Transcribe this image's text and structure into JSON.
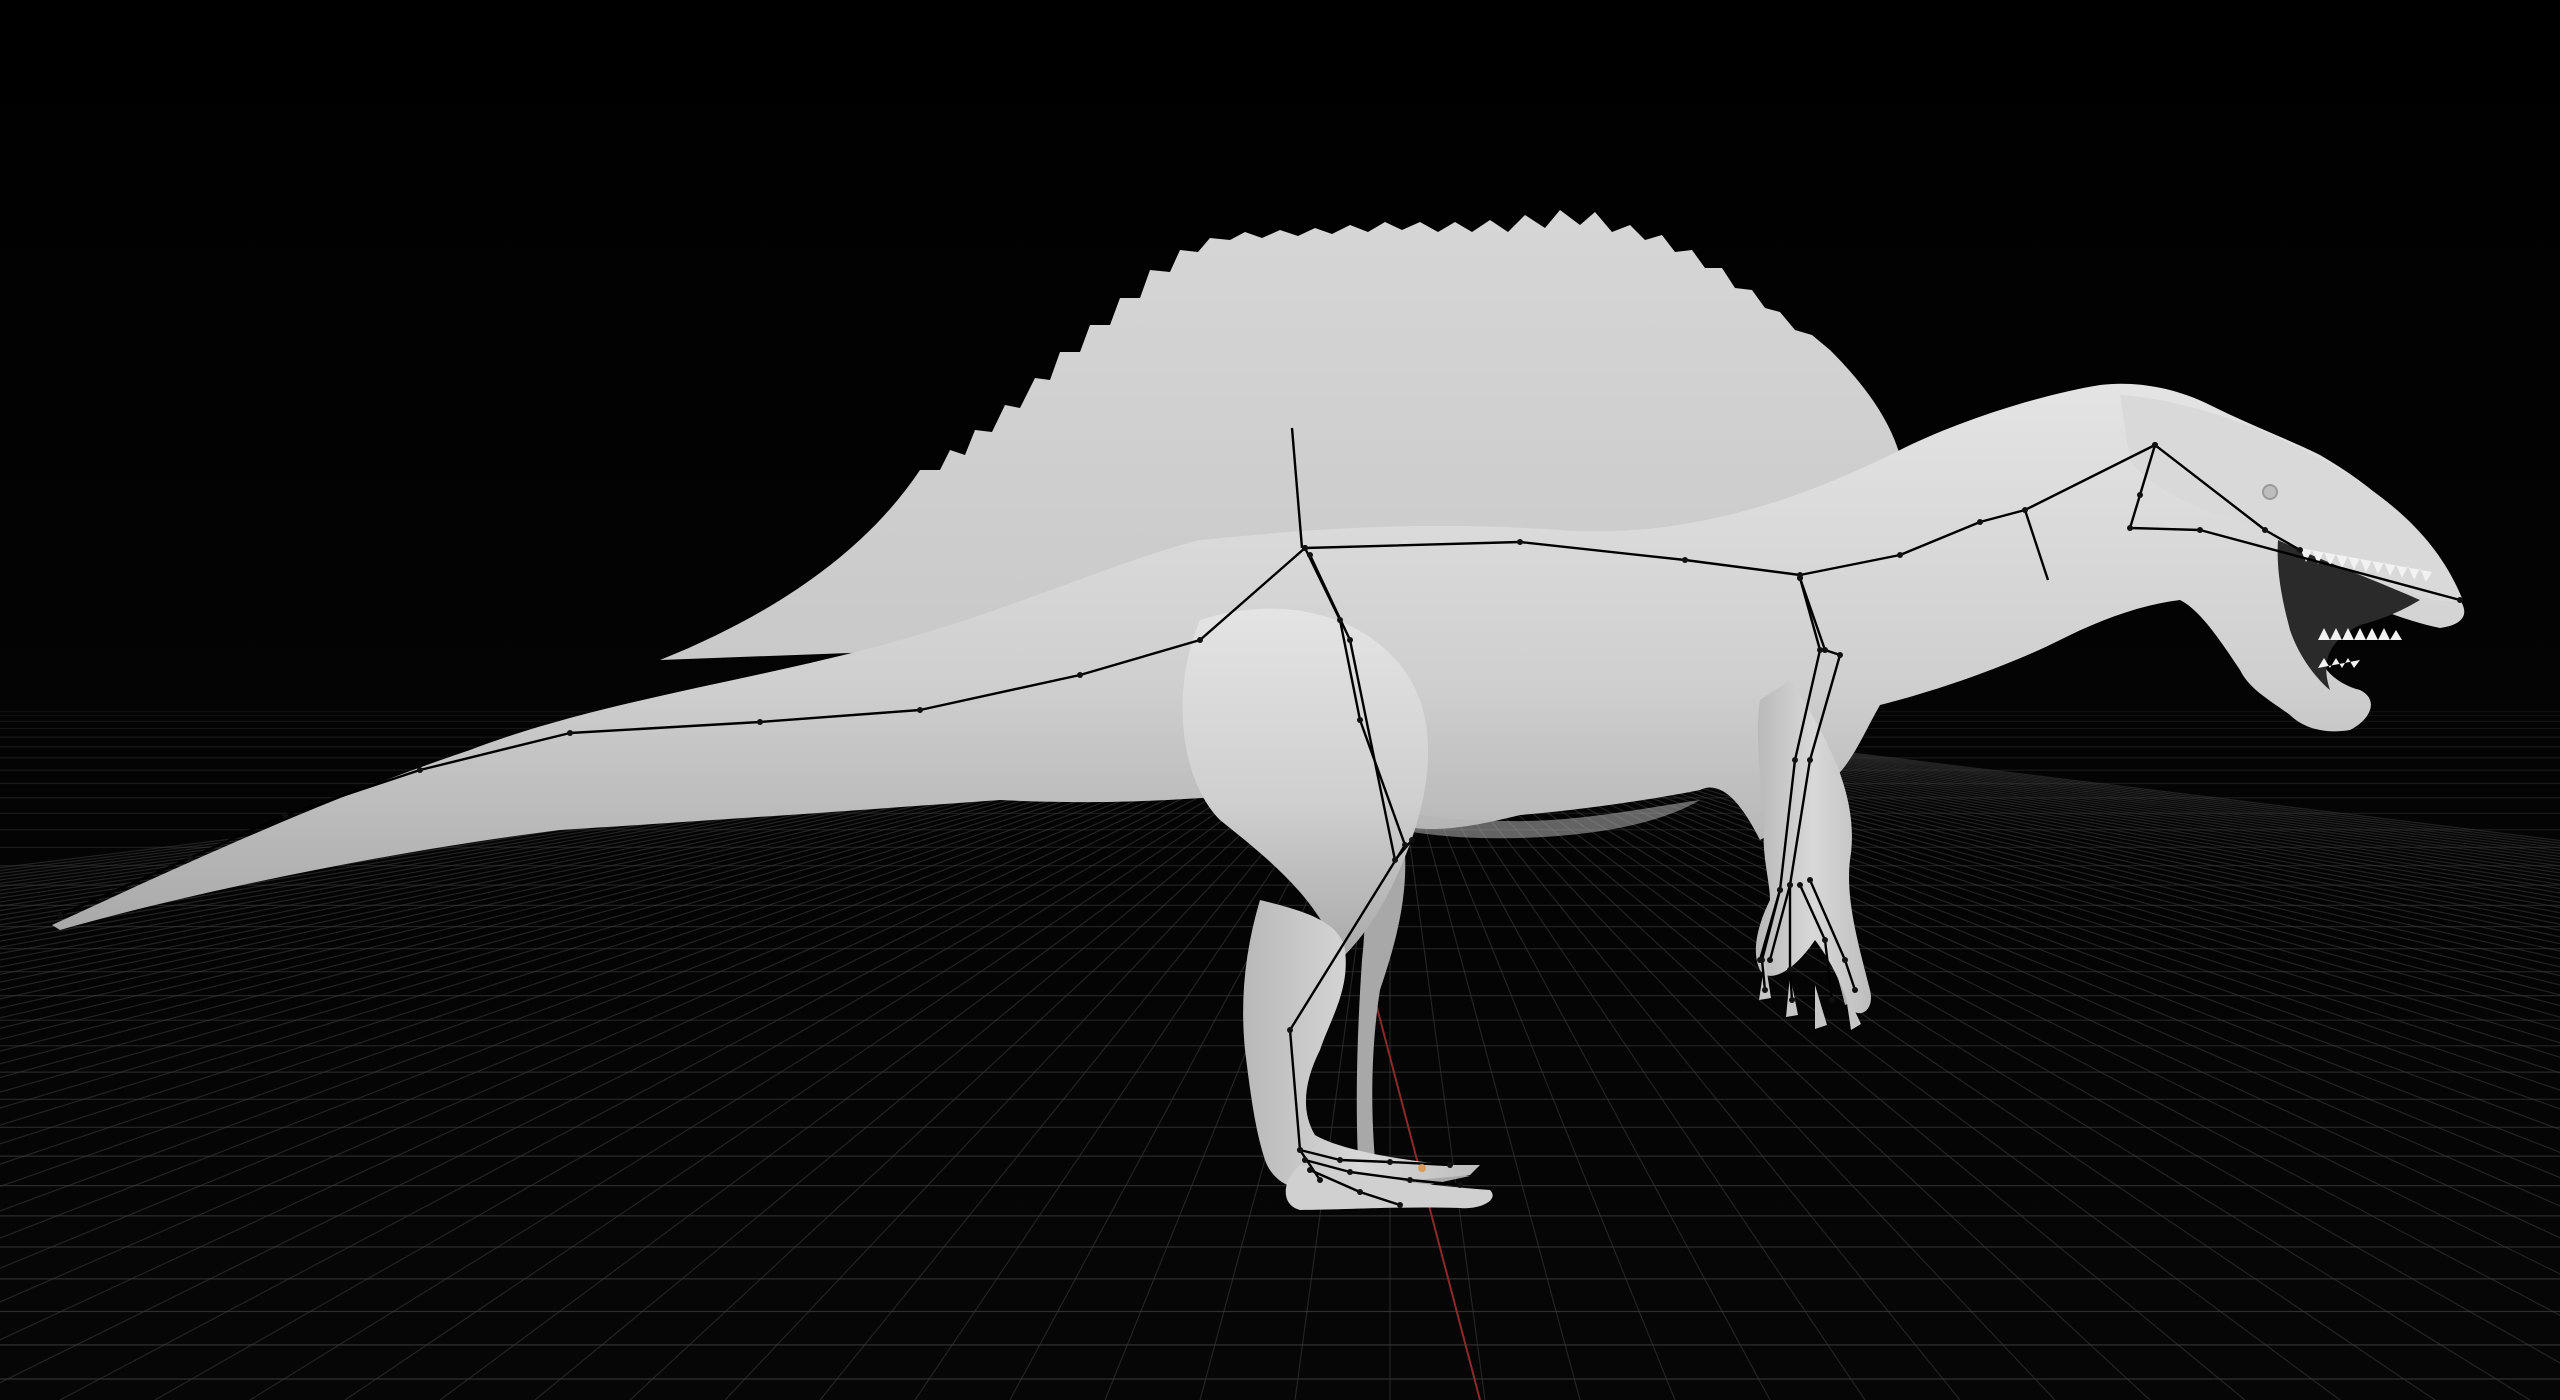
{
  "viewport": {
    "name": "3D Viewport",
    "background_color": "#000000",
    "grid_color": "#3c3c3c",
    "axis_color": "#8a2a2a"
  },
  "model": {
    "subject": "spinosaurus",
    "shading": "clay",
    "skin_color": "#cfcfcf",
    "rig_visible": true,
    "rig_color": "#000000"
  }
}
